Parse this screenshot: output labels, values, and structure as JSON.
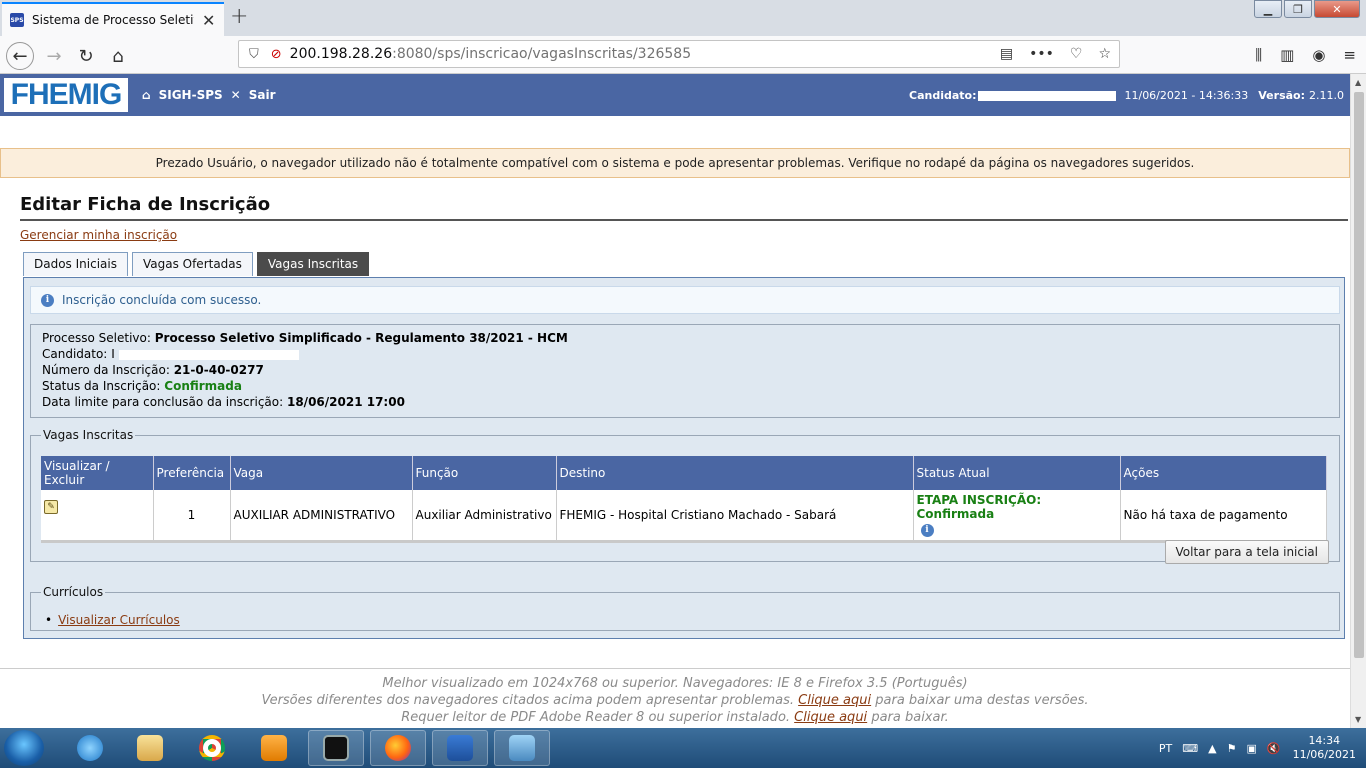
{
  "browser": {
    "tab_title": "Sistema de Processo Seletivo - |",
    "favicon_text": "SPS",
    "url_host": "200.198.28.26",
    "url_path": ":8080/sps/inscricao/vagasInscritas/326585"
  },
  "header": {
    "logo": "FHEMIG",
    "nav_home": "SIGH-SPS",
    "nav_exit": "Sair",
    "candidate_label": "Candidato:",
    "datetime": "11/06/2021 - 14:36:33",
    "version_label": "Versão:",
    "version": "2.11.0"
  },
  "warning": "Prezado Usuário, o navegador utilizado não é totalmente compatível com o sistema e pode apresentar problemas. Verifique no rodapé da página os navegadores sugeridos.",
  "page": {
    "title": "Editar Ficha de Inscrição",
    "manage_link": "Gerenciar minha inscrição",
    "tabs": [
      "Dados Iniciais",
      "Vagas Ofertadas",
      "Vagas Inscritas"
    ],
    "success_message": "Inscrição concluída com sucesso."
  },
  "info": {
    "process_label": "Processo Seletivo:",
    "process_value": "Processo Seletivo Simplificado - Regulamento 38/2021 - HCM",
    "candidate_label": "Candidato:",
    "candidate_value": "I",
    "number_label": "Número da Inscrição:",
    "number_value": "21-0-40-0277",
    "status_label": "Status da Inscrição:",
    "status_value": "Confirmada",
    "deadline_label": "Data limite para conclusão da inscrição:",
    "deadline_value": "18/06/2021 17:00"
  },
  "vagas": {
    "legend": "Vagas Inscritas",
    "headers": [
      "Visualizar / Excluir",
      "Preferência",
      "Vaga",
      "Função",
      "Destino",
      "Status Atual",
      "Ações"
    ],
    "row": {
      "preferencia": "1",
      "vaga": "AUXILIAR ADMINISTRATIVO",
      "funcao": "Auxiliar Administrativo",
      "destino": "FHEMIG - Hospital Cristiano Machado - Sabará",
      "status": "ETAPA INSCRIÇÃO: Confirmada",
      "acoes": "Não há taxa de pagamento"
    },
    "back_button": "Voltar para a tela inicial"
  },
  "curriculos": {
    "legend": "Currículos",
    "link": "Visualizar Currículos"
  },
  "footer": {
    "line1": "Melhor visualizado em 1024x768 ou superior. Navegadores: IE 8 e Firefox 3.5 (Português)",
    "line2_a": "Versões diferentes dos navegadores citados acima podem apresentar problemas.",
    "line2_link": "Clique aqui",
    "line2_b": "para baixar uma destas versões.",
    "line3_a": "Requer leitor de PDF Adobe Reader 8 ou superior instalado.",
    "line3_link": "Clique aqui",
    "line3_b": "para baixar."
  },
  "taskbar": {
    "lang": "PT",
    "time": "14:34",
    "date": "11/06/2021"
  },
  "colors": {
    "header_bg": "#4a66a3",
    "status_green": "#198014",
    "link_brown": "#8a3b12"
  }
}
